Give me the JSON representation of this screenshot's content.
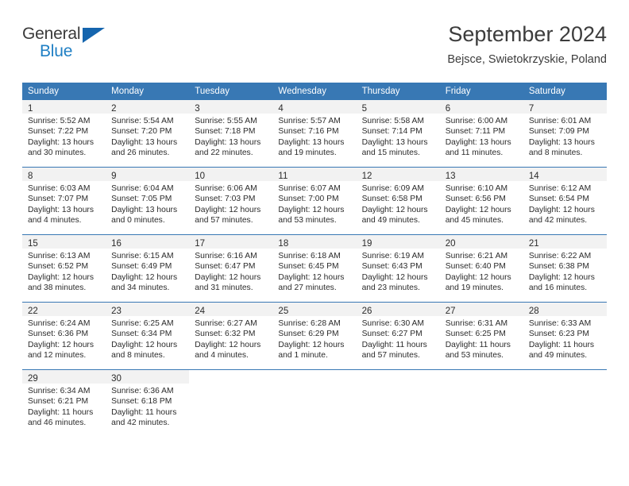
{
  "brand": {
    "name_part1": "General",
    "name_part2": "Blue",
    "triangle_icon": "triangle-logo-icon",
    "accent_dark": "#1565ae",
    "accent_light": "#1f7fc4"
  },
  "header": {
    "title": "September 2024",
    "subtitle": "Bejsce, Swietokrzyskie, Poland"
  },
  "theme": {
    "header_bg": "#3878b4",
    "daynum_bg": "#f2f2f2",
    "row_divider": "#3878b4",
    "text": "#2b2b2b"
  },
  "columns": [
    "Sunday",
    "Monday",
    "Tuesday",
    "Wednesday",
    "Thursday",
    "Friday",
    "Saturday"
  ],
  "weeks": [
    [
      {
        "day": "1",
        "sunrise": "Sunrise: 5:52 AM",
        "sunset": "Sunset: 7:22 PM",
        "daylight1": "Daylight: 13 hours",
        "daylight2": "and 30 minutes."
      },
      {
        "day": "2",
        "sunrise": "Sunrise: 5:54 AM",
        "sunset": "Sunset: 7:20 PM",
        "daylight1": "Daylight: 13 hours",
        "daylight2": "and 26 minutes."
      },
      {
        "day": "3",
        "sunrise": "Sunrise: 5:55 AM",
        "sunset": "Sunset: 7:18 PM",
        "daylight1": "Daylight: 13 hours",
        "daylight2": "and 22 minutes."
      },
      {
        "day": "4",
        "sunrise": "Sunrise: 5:57 AM",
        "sunset": "Sunset: 7:16 PM",
        "daylight1": "Daylight: 13 hours",
        "daylight2": "and 19 minutes."
      },
      {
        "day": "5",
        "sunrise": "Sunrise: 5:58 AM",
        "sunset": "Sunset: 7:14 PM",
        "daylight1": "Daylight: 13 hours",
        "daylight2": "and 15 minutes."
      },
      {
        "day": "6",
        "sunrise": "Sunrise: 6:00 AM",
        "sunset": "Sunset: 7:11 PM",
        "daylight1": "Daylight: 13 hours",
        "daylight2": "and 11 minutes."
      },
      {
        "day": "7",
        "sunrise": "Sunrise: 6:01 AM",
        "sunset": "Sunset: 7:09 PM",
        "daylight1": "Daylight: 13 hours",
        "daylight2": "and 8 minutes."
      }
    ],
    [
      {
        "day": "8",
        "sunrise": "Sunrise: 6:03 AM",
        "sunset": "Sunset: 7:07 PM",
        "daylight1": "Daylight: 13 hours",
        "daylight2": "and 4 minutes."
      },
      {
        "day": "9",
        "sunrise": "Sunrise: 6:04 AM",
        "sunset": "Sunset: 7:05 PM",
        "daylight1": "Daylight: 13 hours",
        "daylight2": "and 0 minutes."
      },
      {
        "day": "10",
        "sunrise": "Sunrise: 6:06 AM",
        "sunset": "Sunset: 7:03 PM",
        "daylight1": "Daylight: 12 hours",
        "daylight2": "and 57 minutes."
      },
      {
        "day": "11",
        "sunrise": "Sunrise: 6:07 AM",
        "sunset": "Sunset: 7:00 PM",
        "daylight1": "Daylight: 12 hours",
        "daylight2": "and 53 minutes."
      },
      {
        "day": "12",
        "sunrise": "Sunrise: 6:09 AM",
        "sunset": "Sunset: 6:58 PM",
        "daylight1": "Daylight: 12 hours",
        "daylight2": "and 49 minutes."
      },
      {
        "day": "13",
        "sunrise": "Sunrise: 6:10 AM",
        "sunset": "Sunset: 6:56 PM",
        "daylight1": "Daylight: 12 hours",
        "daylight2": "and 45 minutes."
      },
      {
        "day": "14",
        "sunrise": "Sunrise: 6:12 AM",
        "sunset": "Sunset: 6:54 PM",
        "daylight1": "Daylight: 12 hours",
        "daylight2": "and 42 minutes."
      }
    ],
    [
      {
        "day": "15",
        "sunrise": "Sunrise: 6:13 AM",
        "sunset": "Sunset: 6:52 PM",
        "daylight1": "Daylight: 12 hours",
        "daylight2": "and 38 minutes."
      },
      {
        "day": "16",
        "sunrise": "Sunrise: 6:15 AM",
        "sunset": "Sunset: 6:49 PM",
        "daylight1": "Daylight: 12 hours",
        "daylight2": "and 34 minutes."
      },
      {
        "day": "17",
        "sunrise": "Sunrise: 6:16 AM",
        "sunset": "Sunset: 6:47 PM",
        "daylight1": "Daylight: 12 hours",
        "daylight2": "and 31 minutes."
      },
      {
        "day": "18",
        "sunrise": "Sunrise: 6:18 AM",
        "sunset": "Sunset: 6:45 PM",
        "daylight1": "Daylight: 12 hours",
        "daylight2": "and 27 minutes."
      },
      {
        "day": "19",
        "sunrise": "Sunrise: 6:19 AM",
        "sunset": "Sunset: 6:43 PM",
        "daylight1": "Daylight: 12 hours",
        "daylight2": "and 23 minutes."
      },
      {
        "day": "20",
        "sunrise": "Sunrise: 6:21 AM",
        "sunset": "Sunset: 6:40 PM",
        "daylight1": "Daylight: 12 hours",
        "daylight2": "and 19 minutes."
      },
      {
        "day": "21",
        "sunrise": "Sunrise: 6:22 AM",
        "sunset": "Sunset: 6:38 PM",
        "daylight1": "Daylight: 12 hours",
        "daylight2": "and 16 minutes."
      }
    ],
    [
      {
        "day": "22",
        "sunrise": "Sunrise: 6:24 AM",
        "sunset": "Sunset: 6:36 PM",
        "daylight1": "Daylight: 12 hours",
        "daylight2": "and 12 minutes."
      },
      {
        "day": "23",
        "sunrise": "Sunrise: 6:25 AM",
        "sunset": "Sunset: 6:34 PM",
        "daylight1": "Daylight: 12 hours",
        "daylight2": "and 8 minutes."
      },
      {
        "day": "24",
        "sunrise": "Sunrise: 6:27 AM",
        "sunset": "Sunset: 6:32 PM",
        "daylight1": "Daylight: 12 hours",
        "daylight2": "and 4 minutes."
      },
      {
        "day": "25",
        "sunrise": "Sunrise: 6:28 AM",
        "sunset": "Sunset: 6:29 PM",
        "daylight1": "Daylight: 12 hours",
        "daylight2": "and 1 minute."
      },
      {
        "day": "26",
        "sunrise": "Sunrise: 6:30 AM",
        "sunset": "Sunset: 6:27 PM",
        "daylight1": "Daylight: 11 hours",
        "daylight2": "and 57 minutes."
      },
      {
        "day": "27",
        "sunrise": "Sunrise: 6:31 AM",
        "sunset": "Sunset: 6:25 PM",
        "daylight1": "Daylight: 11 hours",
        "daylight2": "and 53 minutes."
      },
      {
        "day": "28",
        "sunrise": "Sunrise: 6:33 AM",
        "sunset": "Sunset: 6:23 PM",
        "daylight1": "Daylight: 11 hours",
        "daylight2": "and 49 minutes."
      }
    ],
    [
      {
        "day": "29",
        "sunrise": "Sunrise: 6:34 AM",
        "sunset": "Sunset: 6:21 PM",
        "daylight1": "Daylight: 11 hours",
        "daylight2": "and 46 minutes."
      },
      {
        "day": "30",
        "sunrise": "Sunrise: 6:36 AM",
        "sunset": "Sunset: 6:18 PM",
        "daylight1": "Daylight: 11 hours",
        "daylight2": "and 42 minutes."
      },
      {
        "day": "",
        "sunrise": "",
        "sunset": "",
        "daylight1": "",
        "daylight2": ""
      },
      {
        "day": "",
        "sunrise": "",
        "sunset": "",
        "daylight1": "",
        "daylight2": ""
      },
      {
        "day": "",
        "sunrise": "",
        "sunset": "",
        "daylight1": "",
        "daylight2": ""
      },
      {
        "day": "",
        "sunrise": "",
        "sunset": "",
        "daylight1": "",
        "daylight2": ""
      },
      {
        "day": "",
        "sunrise": "",
        "sunset": "",
        "daylight1": "",
        "daylight2": ""
      }
    ]
  ]
}
